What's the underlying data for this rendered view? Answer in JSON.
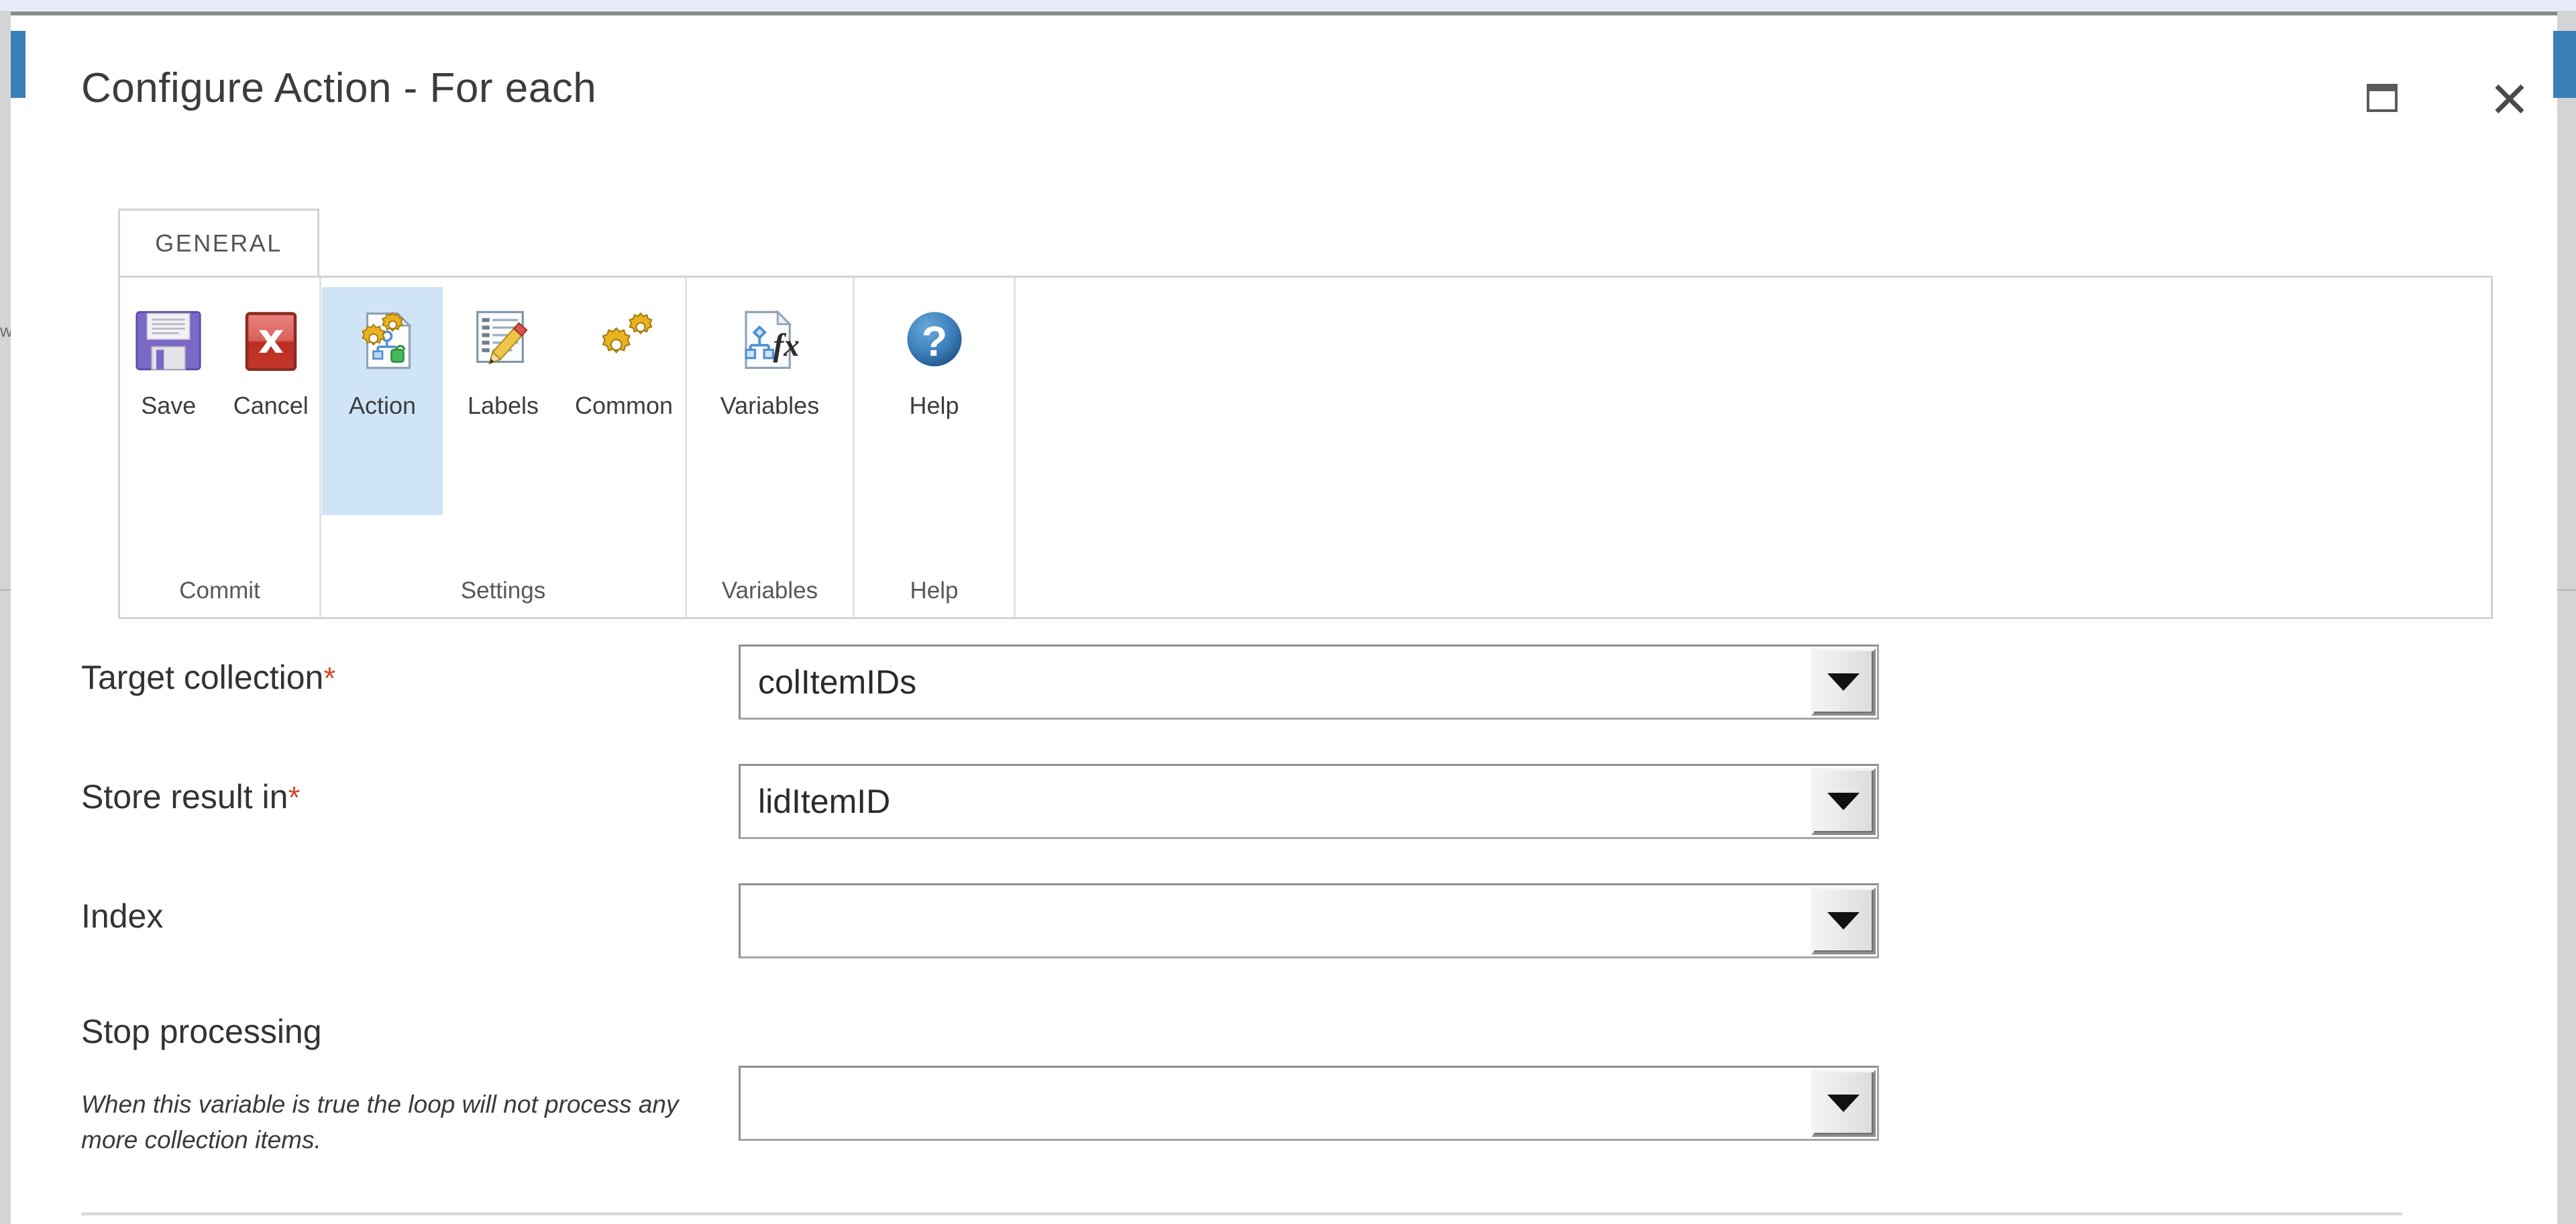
{
  "window": {
    "title": "Configure Action - For each",
    "maximize_icon": "maximize-icon",
    "close_icon": "close-icon",
    "accent_color": "#3b7fb8",
    "title_color": "#3c3c3c"
  },
  "ribbon": {
    "tabs": [
      {
        "label": "GENERAL",
        "active": true
      }
    ],
    "groups": [
      {
        "name": "commit",
        "label": "Commit",
        "buttons": [
          {
            "label": "Save",
            "icon": "floppy-disk-icon",
            "selected": false
          },
          {
            "label": "Cancel",
            "icon": "red-x-icon",
            "selected": false
          }
        ]
      },
      {
        "name": "settings",
        "label": "Settings",
        "buttons": [
          {
            "label": "Action",
            "icon": "gears-document-icon",
            "selected": true
          },
          {
            "label": "Labels",
            "icon": "list-pencil-icon",
            "selected": false
          },
          {
            "label": "Common",
            "icon": "gears-icon",
            "selected": false
          }
        ]
      },
      {
        "name": "variables",
        "label": "Variables",
        "buttons": [
          {
            "label": "Variables",
            "icon": "variables-fx-icon",
            "selected": false
          }
        ]
      },
      {
        "name": "help",
        "label": "Help",
        "buttons": [
          {
            "label": "Help",
            "icon": "question-mark-icon",
            "selected": false
          }
        ]
      }
    ],
    "selection_color": "#cfe5f7"
  },
  "form": {
    "required_marker": "*",
    "required_color": "#d1492d",
    "fields": [
      {
        "label": "Target collection",
        "required": true,
        "value": "colItemIDs",
        "help": ""
      },
      {
        "label": "Store result in",
        "required": true,
        "value": "lidItemID",
        "help": ""
      },
      {
        "label": "Index",
        "required": false,
        "value": "",
        "help": ""
      },
      {
        "label": "Stop processing",
        "required": false,
        "value": "",
        "help": "When this variable is true the loop will not process any more collection items."
      }
    ]
  }
}
